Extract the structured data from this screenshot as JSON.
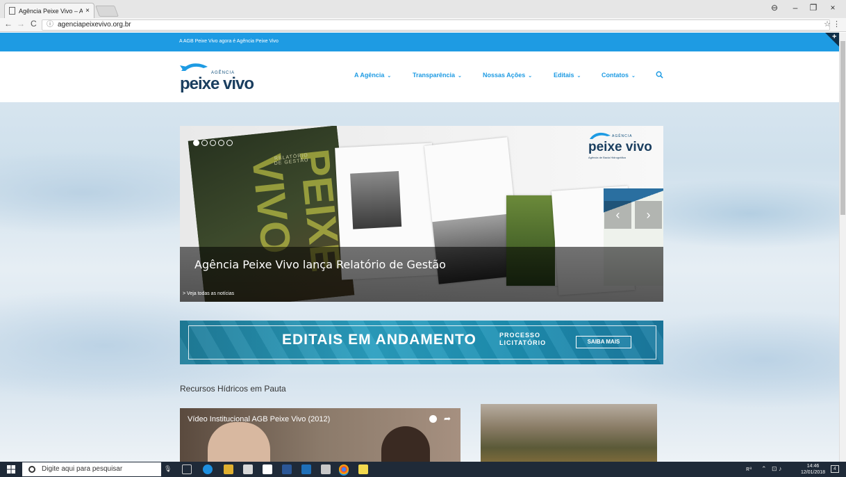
{
  "browser": {
    "tab_title": "Agência Peixe Vivo – Agê",
    "tab_close": "×",
    "url": "agenciapeixevivo.org.br",
    "back": "←",
    "forward": "→",
    "reload": "C",
    "info": "ⓘ",
    "star": "☆",
    "menu": "⋮",
    "window_profile": "⊖",
    "window_minimize": "–",
    "window_maximize": "❐",
    "window_close": "×"
  },
  "site": {
    "topbar_text": "A AGB Peixe Vivo agora é Agência Peixe Vivo",
    "corner_plus": "+",
    "logo_sub": "AGÊNCIA",
    "logo_name": "peixe vivo",
    "nav": [
      {
        "label": "A Agência"
      },
      {
        "label": "Transparência"
      },
      {
        "label": "Nossas Ações"
      },
      {
        "label": "Editais"
      },
      {
        "label": "Contatos"
      }
    ],
    "nav_chevron": "⌄",
    "slider": {
      "caption": "Agência Peixe Vivo lança Relatório de Gestão",
      "link": "> Veja todas as notícias",
      "logo_sub": "AGÊNCIA",
      "logo_name": "peixe vivo",
      "logo_tagline": "Agência de Bacia Hidrográfica",
      "book_text": "RELATÓRIO\nDE GESTÃO",
      "book_big": "PEIXE VIVO",
      "prev": "‹",
      "next": "›",
      "dots": 5,
      "active_dot": 1
    },
    "banner": {
      "title": "EDITAIS EM ANDAMENTO",
      "sub1": "PROCESSO",
      "sub2": "LICITATÓRIO",
      "cta": "SAIBA MAIS"
    },
    "section_title": "Recursos Hídricos em Pauta",
    "video": {
      "title": "Vídeo Institucional AGB Peixe Vivo (2012)",
      "share": "➦"
    }
  },
  "taskbar": {
    "search_placeholder": "Digite aqui para pesquisar",
    "mic": "🎤",
    "tray_person": "ʀ⁸",
    "tray_arrow": "⌃",
    "tray_icons": "⊡ ♪",
    "time": "14:46",
    "date": "12/01/2018",
    "notification": "4"
  }
}
